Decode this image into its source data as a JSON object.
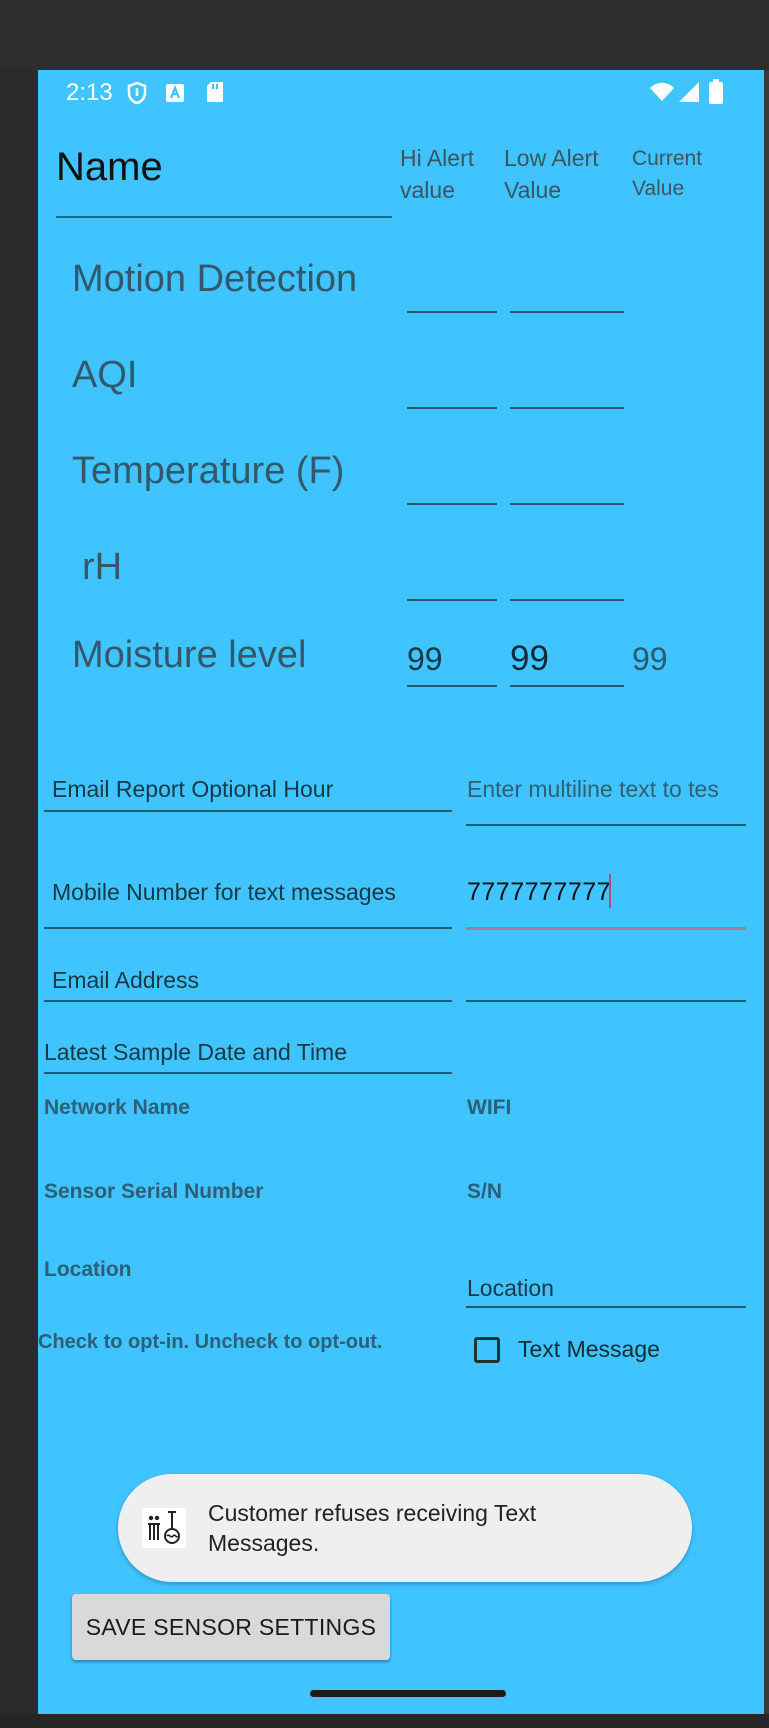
{
  "status_bar": {
    "time": "2:13"
  },
  "header": {
    "name_label": "Name",
    "hi_alert": [
      "Hi Alert",
      "value"
    ],
    "low_alert": [
      "Low Alert",
      "Value"
    ],
    "current": [
      "Current",
      "Value"
    ]
  },
  "rows": [
    {
      "label": "Motion Detection",
      "hi": "",
      "low": "",
      "current": ""
    },
    {
      "label": "AQI",
      "hi": "",
      "low": "",
      "current": ""
    },
    {
      "label": "Temperature (F)",
      "hi": "",
      "low": "",
      "current": ""
    },
    {
      "label": "rH",
      "hi": "",
      "low": "",
      "current": ""
    },
    {
      "label": "Moisture level",
      "hi": "99",
      "low": "99",
      "current": "99"
    }
  ],
  "fields": {
    "email_report_hour": "Email Report Optional Hour",
    "multiline_placeholder": "Enter multiline text to tes",
    "mobile_label": "Mobile Number for text messages",
    "mobile_value": "7777777777",
    "email_address": "Email Address",
    "latest_sample": "Latest Sample Date and Time",
    "network_name_label": "Network Name",
    "network_name_value": "WIFI",
    "serial_label": "Sensor Serial Number",
    "serial_value": "S/N",
    "location_label": "Location",
    "location_value": "Location",
    "opt_in_text": "Check to opt-in.  Uncheck to opt-out.",
    "text_message_label": "Text Message",
    "text_message_checked": false
  },
  "toast": {
    "message": "Customer refuses receiving Text Messages."
  },
  "actions": {
    "save_label": "SAVE SENSOR SETTINGS"
  },
  "icons": [
    "shield-icon",
    "a-badge-icon",
    "sd-card-icon",
    "wifi-icon",
    "signal-icon",
    "battery-icon",
    "app-icon"
  ]
}
